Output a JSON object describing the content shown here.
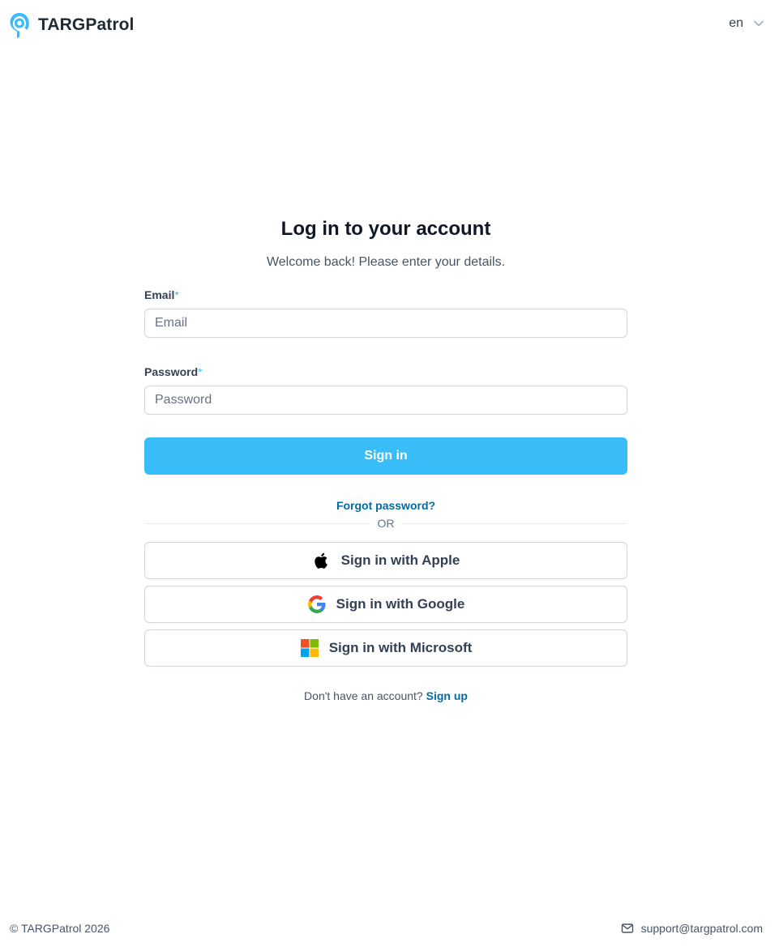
{
  "header": {
    "brand_name": "TARGPatrol",
    "language": "en"
  },
  "login": {
    "title": "Log in to your account",
    "subtitle": "Welcome back! Please enter your details.",
    "email": {
      "label": "Email",
      "required_mark": "*",
      "placeholder": "Email",
      "value": ""
    },
    "password": {
      "label": "Password",
      "required_mark": "*",
      "placeholder": "Password",
      "value": ""
    },
    "sign_in_label": "Sign in",
    "forgot_password_label": "Forgot password?",
    "divider_text": "OR",
    "social": {
      "apple_label": "Sign in with Apple",
      "google_label": "Sign in with Google",
      "microsoft_label": "Sign in with Microsoft"
    },
    "signup_prompt": "Don't have an account?",
    "signup_link": "Sign up"
  },
  "footer": {
    "copyright": "© TARGPatrol 2026",
    "support_email": "support@targpatrol.com"
  },
  "colors": {
    "accent": "#38bdf8",
    "link": "#026aa2",
    "required": "#36bffa",
    "text_primary": "#101828",
    "text_secondary": "#475467",
    "border": "#d0d5dd"
  },
  "icons": {
    "logo": "location-pin-icon",
    "language_dropdown": "chevron-down-icon",
    "apple": "apple-icon",
    "google": "google-icon",
    "microsoft": "microsoft-icon",
    "support": "mail-icon"
  }
}
